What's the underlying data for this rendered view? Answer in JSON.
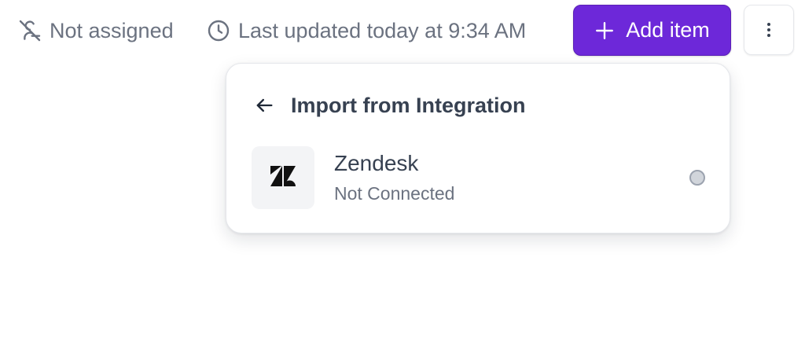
{
  "toolbar": {
    "assignee_label": "Not assigned",
    "assignee_icon": "user-off-icon",
    "updated_label": "Last updated today at 9:34 AM",
    "updated_icon": "clock-icon",
    "add_item_label": "Add item",
    "add_item_icon": "plus-icon",
    "more_icon": "more-vertical-icon"
  },
  "dropdown": {
    "back_icon": "arrow-left-icon",
    "title": "Import from Integration",
    "integrations": [
      {
        "name": "Zendesk",
        "status": "Not Connected",
        "logo_icon": "zendesk-logo-icon",
        "status_indicator": "disconnected"
      }
    ]
  },
  "colors": {
    "accent": "#6d28d9",
    "muted_text": "#6b7280",
    "heading_text": "#374151",
    "status_dot": "#d1d5db"
  }
}
